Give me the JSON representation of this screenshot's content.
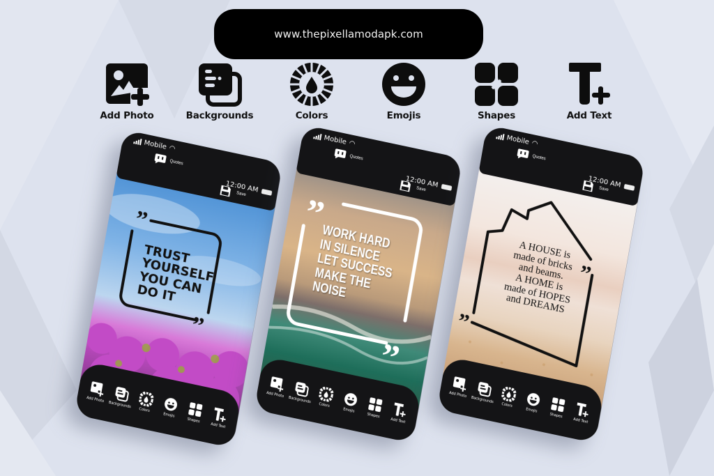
{
  "header": {
    "url": "www.thepixellamodapk.com"
  },
  "features": [
    {
      "label": "Add Photo",
      "icon": "add-photo-icon"
    },
    {
      "label": "Backgrounds",
      "icon": "backgrounds-icon"
    },
    {
      "label": "Colors",
      "icon": "colors-icon"
    },
    {
      "label": "Emojis",
      "icon": "emoji-icon"
    },
    {
      "label": "Shapes",
      "icon": "shapes-icon"
    },
    {
      "label": "Add Text",
      "icon": "add-text-icon"
    }
  ],
  "phones": [
    {
      "status": {
        "carrier": "Mobile",
        "time": "12:00 AM"
      },
      "top_actions": {
        "quotes": "Quotes",
        "save": "Save"
      },
      "quote_lines": [
        "TRUST",
        "YOURSELF",
        "YOU CAN",
        "DO IT"
      ],
      "theme": "sky-flowers"
    },
    {
      "status": {
        "carrier": "Mobile",
        "time": "12:00 AM"
      },
      "top_actions": {
        "quotes": "Quotes",
        "save": "Save"
      },
      "quote_lines": [
        "WORK HARD",
        "IN SILENCE",
        "LET SUCCESS",
        "MAKE THE",
        "NOISE"
      ],
      "theme": "beach-ocean"
    },
    {
      "status": {
        "carrier": "Mobile",
        "time": "12:00 AM"
      },
      "top_actions": {
        "quotes": "Quotes",
        "save": "Save"
      },
      "quote_lines": [
        "A HOUSE is",
        "made of bricks",
        "and beams.",
        "A HOME is",
        "made of HOPES",
        "and DREAMS"
      ],
      "theme": "sand"
    }
  ],
  "toolbar": [
    {
      "label": "Add Photo"
    },
    {
      "label": "Backgrounds"
    },
    {
      "label": "Colors"
    },
    {
      "label": "Emojis"
    },
    {
      "label": "Shapes"
    },
    {
      "label": "Add Text"
    }
  ],
  "colors": {
    "background": "#dde2ee",
    "pill": "#000000",
    "bar": "#141416"
  }
}
